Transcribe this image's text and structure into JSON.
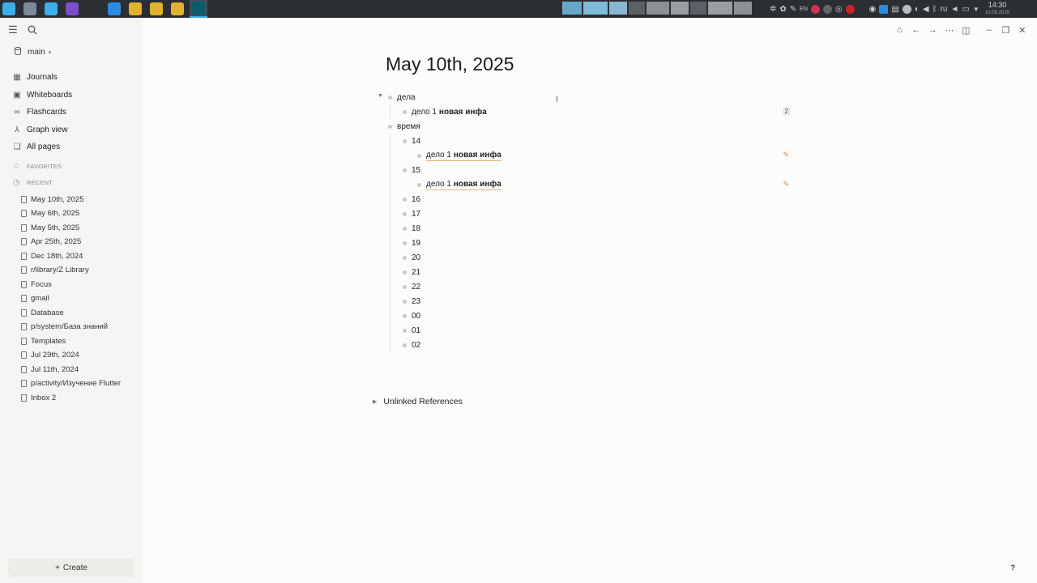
{
  "taskbar": {
    "apps": [
      {
        "name": "launcher",
        "color": "#3daee9"
      },
      {
        "name": "task-manager",
        "color": "#7b8a99"
      },
      {
        "name": "file-manager",
        "color": "#3daee9"
      },
      {
        "name": "obsidian",
        "color": "#7c4dcc"
      },
      {
        "name": "terminal",
        "color": "#2b2e33"
      },
      {
        "name": "vscode",
        "color": "#2a8ce0"
      },
      {
        "name": "chrome",
        "color": "#e2b12f"
      },
      {
        "name": "chrome",
        "color": "#e2b12f"
      },
      {
        "name": "chrome",
        "color": "#e2b12f"
      },
      {
        "name": "logseq",
        "color": "#0a5c6b"
      }
    ],
    "tray_lang_en": "EN",
    "tray_lang": "ru",
    "time": "14:30",
    "date": "10.05.2025"
  },
  "sidebar": {
    "graph": "main",
    "nav": [
      {
        "label": "Journals",
        "icon": "calendar-icon"
      },
      {
        "label": "Whiteboards",
        "icon": "whiteboard-icon"
      },
      {
        "label": "Flashcards",
        "icon": "flashcards-icon"
      },
      {
        "label": "Graph view",
        "icon": "graph-icon"
      },
      {
        "label": "All pages",
        "icon": "pages-icon"
      }
    ],
    "favorites_label": "FAVORITES",
    "recent_label": "RECENT",
    "recent": [
      "May 10th, 2025",
      "May 6th, 2025",
      "May 5th, 2025",
      "Apr 25th, 2025",
      "Dec 18th, 2024",
      "r/library/Z Library",
      "Focus",
      "gmail",
      "Database",
      "p/system/База знаний",
      "Templates",
      "Jul 29th, 2024",
      "Jul 11th, 2024",
      "p/activity/Изучение Flutter",
      "Inbox 2"
    ],
    "create_label": "Create"
  },
  "page": {
    "title": "May 10th, 2025",
    "blocks": {
      "dela": "дела",
      "delo_text": "дело 1",
      "delo_bold": "новая инфа",
      "ref_count": "2",
      "vremya": "время",
      "hours": [
        "14",
        "15",
        "16",
        "17",
        "18",
        "19",
        "20",
        "21",
        "22",
        "23",
        "00",
        "01",
        "02"
      ]
    },
    "unlinked_references": "Unlinked References",
    "help": "?"
  }
}
